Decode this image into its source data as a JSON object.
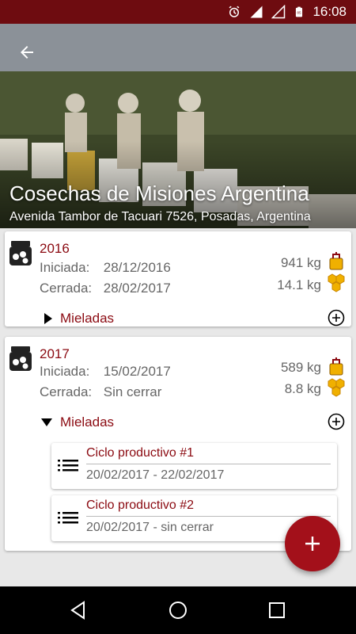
{
  "status_bar": {
    "time": "16:08",
    "battery_level": "85",
    "icons": [
      "alarm-icon",
      "signal-icon",
      "no-sim-icon",
      "battery-icon"
    ],
    "background": "#6e0c10"
  },
  "header": {
    "title": "Cosechas de Misiones Argentina",
    "address": "Avenida Tambor de Tacuari 7526, Posadas, Argentina",
    "back_icon": "arrow-back-icon"
  },
  "harvests": [
    {
      "year": "2016",
      "started_label": "Iniciada:",
      "started": "28/12/2016",
      "closed_label": "Cerrada:",
      "closed": "28/02/2017",
      "honey_kg": "941 kg",
      "comb_kg": "14.1 kg",
      "mieladas_label": "Mieladas",
      "expanded": false,
      "cycles": []
    },
    {
      "year": "2017",
      "started_label": "Iniciada:",
      "started": "15/02/2017",
      "closed_label": "Cerrada:",
      "closed": "Sin cerrar",
      "honey_kg": "589 kg",
      "comb_kg": "8.8 kg",
      "mieladas_label": "Mieladas",
      "expanded": true,
      "cycles": [
        {
          "title": "Ciclo productivo #1",
          "dates": "20/02/2017 - 22/02/2017"
        },
        {
          "title": "Ciclo productivo #2",
          "dates": "20/02/2017 - sin cerrar"
        }
      ]
    }
  ],
  "fab": {
    "icon": "plus-icon",
    "color": "#a3101a"
  },
  "colors": {
    "accent": "#8b0a11",
    "text_secondary": "#666666",
    "honey": "#f0b000"
  }
}
